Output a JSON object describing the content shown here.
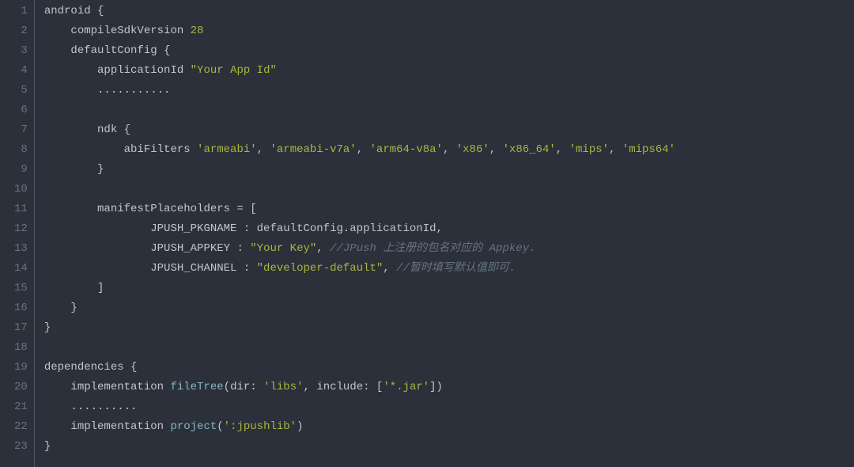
{
  "colors": {
    "bg": "#2B303B",
    "fg": "#C0C5CE",
    "gutter": "#65737E",
    "number": "#AAB73B",
    "string": "#AAB73B",
    "func": "#86B5C2",
    "comment": "#65737E"
  },
  "line_count": 23,
  "lines": [
    [
      [
        "android {",
        "default"
      ]
    ],
    [
      [
        "    compileSdkVersion ",
        "default"
      ],
      [
        "28",
        "num"
      ]
    ],
    [
      [
        "    defaultConfig {",
        "default"
      ]
    ],
    [
      [
        "        applicationId ",
        "default"
      ],
      [
        "\"Your App Id\"",
        "string"
      ]
    ],
    [
      [
        "        ...........",
        "default"
      ]
    ],
    [
      [
        "",
        "default"
      ]
    ],
    [
      [
        "        ndk {",
        "default"
      ]
    ],
    [
      [
        "            abiFilters ",
        "default"
      ],
      [
        "'armeabi'",
        "string"
      ],
      [
        ", ",
        "default"
      ],
      [
        "'armeabi-v7a'",
        "string"
      ],
      [
        ", ",
        "default"
      ],
      [
        "'arm64-v8a'",
        "string"
      ],
      [
        ", ",
        "default"
      ],
      [
        "'x86'",
        "string"
      ],
      [
        ", ",
        "default"
      ],
      [
        "'x86_64'",
        "string"
      ],
      [
        ", ",
        "default"
      ],
      [
        "'mips'",
        "string"
      ],
      [
        ", ",
        "default"
      ],
      [
        "'mips64'",
        "string"
      ]
    ],
    [
      [
        "        }",
        "default"
      ]
    ],
    [
      [
        "",
        "default"
      ]
    ],
    [
      [
        "        manifestPlaceholders = [",
        "default"
      ]
    ],
    [
      [
        "                JPUSH_PKGNAME : defaultConfig.applicationId,",
        "default"
      ]
    ],
    [
      [
        "                JPUSH_APPKEY : ",
        "default"
      ],
      [
        "\"Your Key\"",
        "string"
      ],
      [
        ", ",
        "default"
      ],
      [
        "//JPush 上注册的包名对应的 Appkey.",
        "comment"
      ]
    ],
    [
      [
        "                JPUSH_CHANNEL : ",
        "default"
      ],
      [
        "\"developer-default\"",
        "string"
      ],
      [
        ", ",
        "default"
      ],
      [
        "//暂时填写默认值即可.",
        "comment"
      ]
    ],
    [
      [
        "        ]",
        "default"
      ]
    ],
    [
      [
        "    }",
        "default"
      ]
    ],
    [
      [
        "}",
        "default"
      ]
    ],
    [
      [
        "",
        "default"
      ]
    ],
    [
      [
        "dependencies {",
        "default"
      ]
    ],
    [
      [
        "    implementation ",
        "default"
      ],
      [
        "fileTree",
        "func"
      ],
      [
        "(dir: ",
        "default"
      ],
      [
        "'libs'",
        "string"
      ],
      [
        ", include: [",
        "default"
      ],
      [
        "'*.jar'",
        "string"
      ],
      [
        "])",
        "default"
      ]
    ],
    [
      [
        "    ..........",
        "default"
      ]
    ],
    [
      [
        "    implementation ",
        "default"
      ],
      [
        "project",
        "func"
      ],
      [
        "(",
        "default"
      ],
      [
        "':jpushlib'",
        "string"
      ],
      [
        ")",
        "default"
      ]
    ],
    [
      [
        "}",
        "default"
      ]
    ]
  ]
}
